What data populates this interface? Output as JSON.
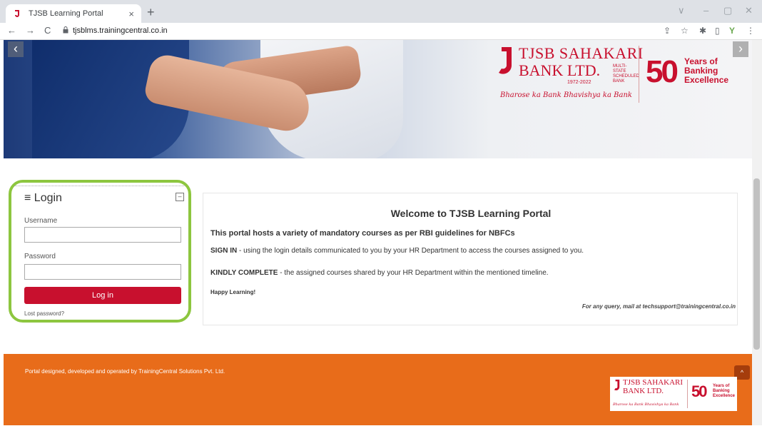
{
  "browser": {
    "tab_title": "TJSB Learning Portal",
    "tab_close": "×",
    "new_tab": "+",
    "url": "tjsblms.trainingcentral.co.in",
    "back": "←",
    "forward": "→",
    "reload": "C",
    "lock": "🔒",
    "share": "⇪",
    "star": "☆",
    "extension": "✱",
    "sidepanel": "▯",
    "profile": "Y",
    "menu": "⋮",
    "win_down": "∨",
    "win_min": "–",
    "win_max": "▢",
    "win_close": "✕"
  },
  "banner": {
    "prev": "‹",
    "next": "›",
    "logo_line1": "TJSB SAHAKARI",
    "logo_line2": "BANK LTD.",
    "logo_multistate": "MULTI-STATE SCHEDULED BANK",
    "logo_years": "1972-2022",
    "logo_tagline": "Bharose ka Bank Bhavishya ka Bank",
    "anniv_number": "50",
    "anniv_text": "Years of Banking Excellence"
  },
  "login": {
    "menu_icon": "≡",
    "title": "Login",
    "collapse": "–",
    "username_label": "Username",
    "username_value": "",
    "password_label": "Password",
    "password_value": "",
    "button": "Log in",
    "lost_password": "Lost password?"
  },
  "welcome": {
    "title": "Welcome to TJSB Learning Portal",
    "subtitle": "This portal hosts a variety of mandatory courses as per RBI guidelines for NBFCs",
    "signin_strong": "SIGN IN",
    "signin_text": " - using the login details communicated to you by your HR Department to access the courses assigned to you.",
    "complete_strong": "KINDLY COMPLETE",
    "complete_text": " - the assigned courses shared by your HR Department within the mentioned timeline.",
    "happy": "Happy Learning!",
    "query": "For any query, mail at techsupport@trainingcentral.co.in"
  },
  "footer": {
    "text": "Portal designed, developed and operated by TrainingCentral Solutions Pvt. Ltd.",
    "up": "^",
    "logo_line1": "TJSB SAHAKARI",
    "logo_line2": "BANK LTD.",
    "logo_tagline": "Bharose ka Bank Bhavishya ka Bank",
    "anniv_number": "50",
    "anniv_text": "Years of Banking Excellence"
  },
  "colors": {
    "accent": "#c8102e",
    "highlight": "#8dc63f",
    "footer": "#e86c1a"
  }
}
